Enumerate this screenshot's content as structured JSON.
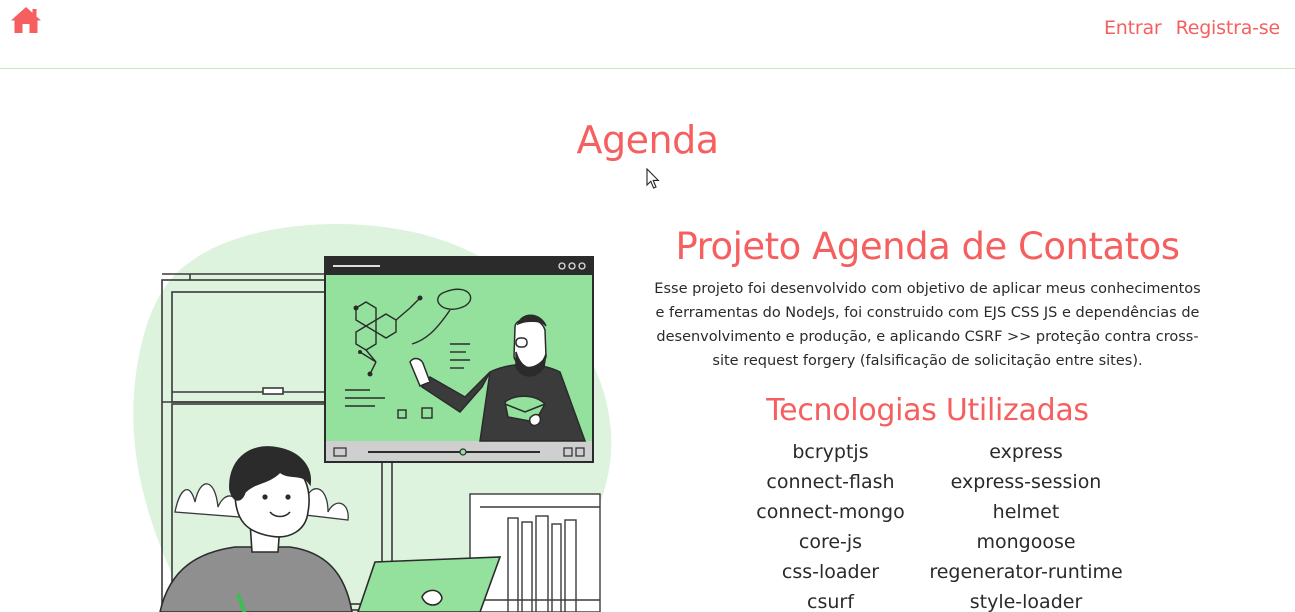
{
  "nav": {
    "links": [
      {
        "label": "Entrar"
      },
      {
        "label": "Registra-se"
      }
    ],
    "accent_color": "#f65f5f"
  },
  "page": {
    "title": "Agenda"
  },
  "project": {
    "title": "Projeto Agenda de Contatos",
    "description": "Esse projeto foi desenvolvido com objetivo de aplicar meus conhecimentos e ferramentas do NodeJs, foi construido com EJS CSS JS e dependências de desenvolvimento e produção, e aplicando CSRF >> proteção contra cross-site request forgery (falsificação de solicitação entre sites).",
    "tech_title": "Tecnologias Utilizadas",
    "technologies": [
      "bcryptjs",
      "express",
      "connect-flash",
      "express-session",
      "connect-mongo",
      "helmet",
      "core-js",
      "mongoose",
      "css-loader",
      "regenerator-runtime",
      "csurf",
      "style-loader"
    ]
  },
  "icons": {
    "home": "home-icon",
    "cursor": "mouse-cursor-icon"
  }
}
